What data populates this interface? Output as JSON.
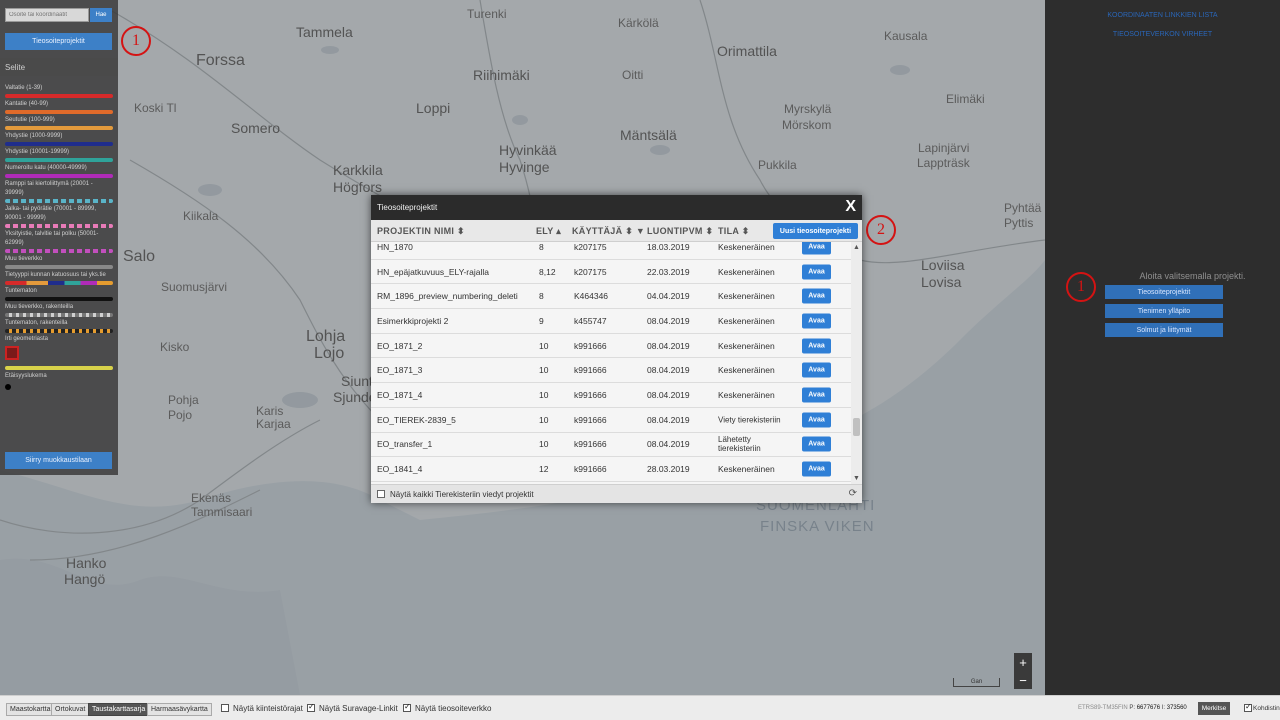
{
  "colors": {
    "primary_button": "#2f7fd6",
    "dialog_header": "#2b2b2b",
    "annotation": "#d41313",
    "panel_bg": "#2d2d2d"
  },
  "map": {
    "places": [
      {
        "name": "Turenki",
        "size": "sm"
      },
      {
        "name": "Tammela",
        "size": "md"
      },
      {
        "name": "Forssa",
        "size": "lg"
      },
      {
        "name": "Riihimäki",
        "size": "md"
      },
      {
        "name": "Oitti",
        "size": "sm"
      },
      {
        "name": "Kärkölä",
        "size": "sm"
      },
      {
        "name": "Orimattila",
        "size": "md"
      },
      {
        "name": "Kausala",
        "size": "sm"
      },
      {
        "name": "Koski Tl",
        "size": "sm"
      },
      {
        "name": "Loppi",
        "size": "md"
      },
      {
        "name": "Mäntsälä",
        "size": "md"
      },
      {
        "name": "Myrskylä",
        "size": "sm"
      },
      {
        "name": "Mörskom",
        "size": "sm"
      },
      {
        "name": "Elimäki",
        "size": "sm"
      },
      {
        "name": "Somero",
        "size": "md"
      },
      {
        "name": "Hyvinkää",
        "size": "md"
      },
      {
        "name": "Hyvinge",
        "size": "md"
      },
      {
        "name": "Pukkila",
        "size": "sm"
      },
      {
        "name": "Lapinjärvi",
        "size": "sm"
      },
      {
        "name": "Lappträsk",
        "size": "sm"
      },
      {
        "name": "Karkkila",
        "size": "md"
      },
      {
        "name": "Högfors",
        "size": "md"
      },
      {
        "name": "Kiikala",
        "size": "sm"
      },
      {
        "name": "Pyhtää",
        "size": "sm"
      },
      {
        "name": "Pyttis",
        "size": "sm"
      },
      {
        "name": "Salo",
        "size": "lg"
      },
      {
        "name": "Loviisa",
        "size": "md"
      },
      {
        "name": "Lovisa",
        "size": "md"
      },
      {
        "name": "Suomusjärvi",
        "size": "sm"
      },
      {
        "name": "Lohja",
        "size": "lg"
      },
      {
        "name": "Lojo",
        "size": "lg"
      },
      {
        "name": "Kisko",
        "size": "sm"
      },
      {
        "name": "Siunt",
        "size": "md"
      },
      {
        "name": "Sjunde",
        "size": "md"
      },
      {
        "name": "Pohja",
        "size": "sm"
      },
      {
        "name": "Pojo",
        "size": "sm"
      },
      {
        "name": "Karis",
        "size": "sm"
      },
      {
        "name": "Karjaa",
        "size": "sm"
      },
      {
        "name": "Ekenäs",
        "size": "sm"
      },
      {
        "name": "Tammisaari",
        "size": "sm"
      },
      {
        "name": "Hanko",
        "size": "md"
      },
      {
        "name": "Hangö",
        "size": "md"
      },
      {
        "name": "SUOMENLAHTI",
        "size": "sea"
      },
      {
        "name": "FINSKA VIKEN",
        "size": "sea"
      }
    ],
    "scale_label": "Gan"
  },
  "left_panel": {
    "search_placeholder": "Osoite tai koordinaatit",
    "search_button": "Hae",
    "projects_button": "Tieosoiteprojektit",
    "legend_title": "Selite",
    "legend": [
      {
        "label": "Valtatie (1-39)",
        "color": "#d62a2a"
      },
      {
        "label": "Kantatie (40-99)",
        "color": "#e06a2a"
      },
      {
        "label": "Seututie (100-999)",
        "color": "#e39a3c"
      },
      {
        "label": "Yhdystie (1000-9999)",
        "color": "#1f2d8c"
      },
      {
        "label": "Yhdystie (10001-19999)",
        "color": "#2fa39a"
      },
      {
        "label": "Numeroitu katu (40000-49999)",
        "color": "#b02bb8"
      },
      {
        "label": "Ramppi tai kiertoliittymä (20001 - 39999)",
        "color": "#5ab4c8"
      },
      {
        "label": "Jalka- tai pyörätie (70001 - 89999, 90001 - 99999)",
        "color": "#e87bb8"
      },
      {
        "label": "Yksityistie, talvitie tai polku (50001-62999)",
        "color": "#c24fbd"
      },
      {
        "label": "Muu tieverkko",
        "color": "#888888"
      },
      {
        "label": "Tietyyppi kunnan katuosuus tai yks.tie",
        "color": "#e59c2f"
      },
      {
        "label": "Tuntematon",
        "color": "#111111"
      },
      {
        "label": "Muu tieverkko, rakenteilla",
        "color": "#777777"
      },
      {
        "label": "Tuntematon, rakenteilla",
        "color": "#222222"
      },
      {
        "label": "Irti geometriasta",
        "color": "#cc2222"
      },
      {
        "label": "Etäisyyslukema",
        "color": "#000000"
      }
    ],
    "edit_mode_button": "Siirry muokkaustilaan"
  },
  "right_panel": {
    "link_calibration": "KOORDINAATEN LINKKIEN LISTA",
    "link_errors": "TIEOSOITEVERKON VIRHEET",
    "hint": "Aloita valitsemalla projekti.",
    "buttons": [
      "Tieosoiteprojektit",
      "Tienimen ylläpito",
      "Solmut ja liittymät"
    ]
  },
  "annotations": [
    "1",
    "2",
    "1"
  ],
  "dialog": {
    "title": "Tieosoiteprojektit",
    "close": "X",
    "columns": {
      "name": "PROJEKTIN NIMI",
      "ely": "ELY",
      "user": "KÄYTTÄJÄ",
      "created": "LUONTIPVM",
      "state": "TILA"
    },
    "new_project_button": "Uusi tieosoiteprojekti",
    "rows": [
      {
        "name": "HN_1870",
        "ely": "8",
        "user": "k207175",
        "date": "18.03.2019",
        "state": "Keskeneräinen",
        "action": "Avaa"
      },
      {
        "name": "HN_epäjatkuvuus_ELY-rajalla",
        "ely": "8,12",
        "user": "k207175",
        "date": "22.03.2019",
        "state": "Keskeneräinen",
        "action": "Avaa"
      },
      {
        "name": "RM_1896_preview_numbering_deleti",
        "ely": "8",
        "user": "K464346",
        "date": "04.04.2019",
        "state": "Keskeneräinen",
        "action": "Avaa"
      },
      {
        "name": "Esimerkkiprojekti 2",
        "ely": "9",
        "user": "k455747",
        "date": "08.04.2019",
        "state": "Keskeneräinen",
        "action": "Avaa"
      },
      {
        "name": "EO_1871_2",
        "ely": "10",
        "user": "k991666",
        "date": "08.04.2019",
        "state": "Keskeneräinen",
        "action": "Avaa"
      },
      {
        "name": "EO_1871_3",
        "ely": "10",
        "user": "k991666",
        "date": "08.04.2019",
        "state": "Keskeneräinen",
        "action": "Avaa"
      },
      {
        "name": "EO_1871_4",
        "ely": "10",
        "user": "k991666",
        "date": "08.04.2019",
        "state": "Keskeneräinen",
        "action": "Avaa"
      },
      {
        "name": "EO_TIEREK-2839_5",
        "ely": "10",
        "user": "k991666",
        "date": "08.04.2019",
        "state": "Viety tierekisteriin",
        "action": "Avaa"
      },
      {
        "name": "EO_transfer_1",
        "ely": "10",
        "user": "k991666",
        "date": "08.04.2019",
        "state": "Lähetetty tierekisteriin",
        "action": "Avaa"
      },
      {
        "name": "EO_1841_4",
        "ely": "12",
        "user": "k991666",
        "date": "28.03.2019",
        "state": "Keskeneräinen",
        "action": "Avaa"
      }
    ],
    "footer_checkbox": "Näytä kaikki Tierekisteriin viedyt projektit"
  },
  "zoom": {
    "in": "+",
    "out": "−"
  },
  "bottom_bar": {
    "backgrounds": [
      {
        "label": "Maastokartta",
        "active": false
      },
      {
        "label": "Ortokuvat",
        "active": false
      },
      {
        "label": "Taustakarttasarja",
        "active": true
      },
      {
        "label": "Harmaasävykartta",
        "active": false
      }
    ],
    "toggles": [
      {
        "label": "Näytä kiinteistörajat",
        "checked": false
      },
      {
        "label": "Näytä Suravage-Linkit",
        "checked": true
      },
      {
        "label": "Näytä tieosoiteverkko",
        "checked": true
      }
    ],
    "crs": "ETRS89-TM35FIN",
    "p_label": "P:",
    "p_value": "6677676",
    "i_label": "I:",
    "i_value": "373560",
    "mark_button": "Merkitse",
    "crosshair_label": "Kohdistin"
  }
}
